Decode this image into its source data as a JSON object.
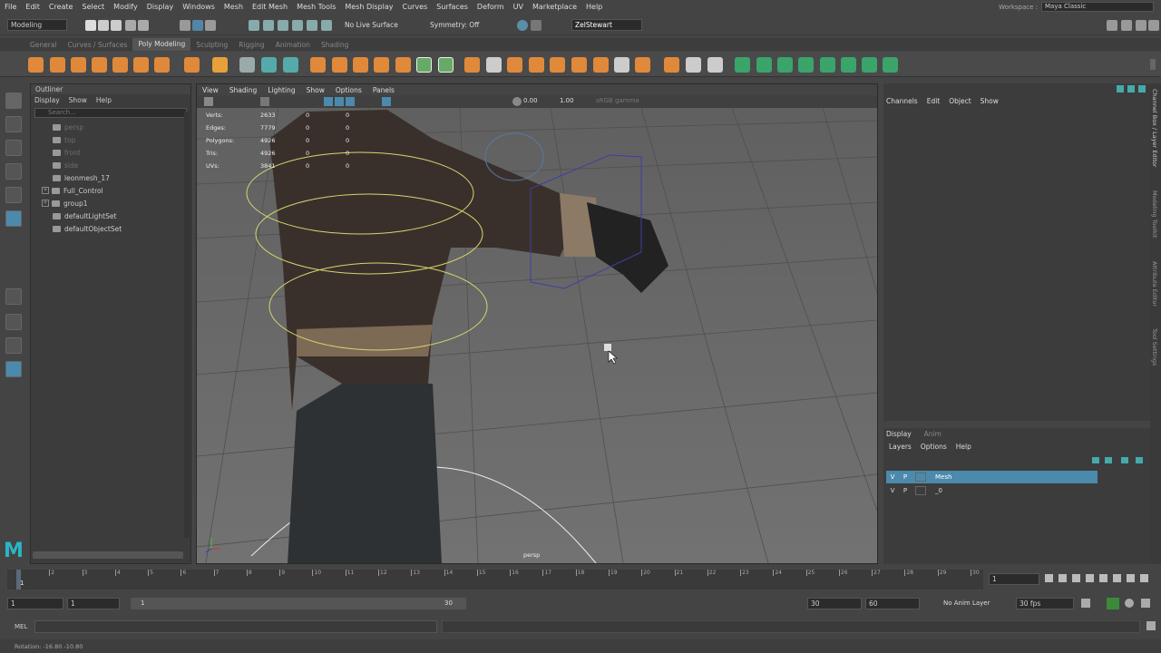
{
  "menubar": [
    "File",
    "Edit",
    "Create",
    "Select",
    "Modify",
    "Display",
    "Windows",
    "Mesh",
    "Edit Mesh",
    "Mesh Tools",
    "Mesh Display",
    "Curves",
    "Surfaces",
    "Deform",
    "UV",
    "Marketplace",
    "Help"
  ],
  "workspace": {
    "label": "Workspace :",
    "value": "Maya Classic"
  },
  "status": {
    "mode": "Modeling",
    "live_surface": "No Live Surface",
    "symmetry": "Symmetry: Off",
    "user": "ZelStewart"
  },
  "shelf_tabs": [
    "General",
    "Curves / Surfaces",
    "Poly Modeling",
    "Sculpting",
    "Rigging",
    "Animation",
    "Shading"
  ],
  "shelf_active": "Poly Modeling",
  "outliner": {
    "title": "Outliner",
    "menu": [
      "Display",
      "Show",
      "Help"
    ],
    "search": "Search...",
    "items": [
      {
        "label": "persp",
        "dim": true
      },
      {
        "label": "top",
        "dim": true
      },
      {
        "label": "front",
        "dim": true
      },
      {
        "label": "side",
        "dim": true
      },
      {
        "label": "leonmesh_17",
        "dim": false
      },
      {
        "label": "Full_Control",
        "dim": false,
        "expand": "+"
      },
      {
        "label": "group1",
        "dim": false,
        "expand": "+"
      },
      {
        "label": "defaultLightSet",
        "dim": false
      },
      {
        "label": "defaultObjectSet",
        "dim": false
      }
    ]
  },
  "viewport": {
    "menu": [
      "View",
      "Shading",
      "Lighting",
      "Show",
      "Options",
      "Panels"
    ],
    "val1": "0.00",
    "val2": "1.00",
    "colorspace": "sRGB gamma",
    "camera": "persp",
    "hud": [
      {
        "k": "Verts:",
        "v": "2633",
        "a": "0",
        "b": "0"
      },
      {
        "k": "Edges:",
        "v": "7779",
        "a": "0",
        "b": "0"
      },
      {
        "k": "Polygons:",
        "v": "4926",
        "a": "0",
        "b": "0"
      },
      {
        "k": "Tris:",
        "v": "4926",
        "a": "0",
        "b": "0"
      },
      {
        "k": "UVs:",
        "v": "3841",
        "a": "0",
        "b": "0"
      }
    ]
  },
  "channelbox": {
    "menu": [
      "Channels",
      "Edit",
      "Object",
      "Show"
    ]
  },
  "layers": {
    "tabs": [
      "Display",
      "Anim"
    ],
    "menu": [
      "Layers",
      "Options",
      "Help"
    ],
    "rows": [
      {
        "v": "V",
        "p": "P",
        "name": "Mesh",
        "selected": true
      },
      {
        "v": "V",
        "p": "P",
        "name": "_0",
        "selected": false
      }
    ]
  },
  "side_tabs": [
    "Channel Box / Layer Editor",
    "Modeling Toolkit",
    "Attribute Editor",
    "Tool Settings"
  ],
  "timeline": {
    "ticks": [
      "1",
      "2",
      "3",
      "4",
      "5",
      "6",
      "7",
      "8",
      "9",
      "10",
      "11",
      "12",
      "13",
      "14",
      "15",
      "16",
      "17",
      "18",
      "19",
      "20",
      "21",
      "22",
      "23",
      "24",
      "25",
      "26",
      "27",
      "28",
      "29",
      "30"
    ],
    "current": "1"
  },
  "range": {
    "start": "1",
    "start2": "1",
    "slider_start": "1",
    "slider_end": "30",
    "end": "30",
    "end2": "60",
    "anim_layer": "No Anim Layer",
    "fps": "30 fps"
  },
  "cmd": {
    "label": "MEL"
  },
  "help": {
    "text": "Rotation:  -16.80    -10.80"
  },
  "colors": {
    "accent": "#5285a6",
    "select": "#4b8aad",
    "wire": "#c9c86a",
    "bg_view": "#6b6b6b"
  }
}
